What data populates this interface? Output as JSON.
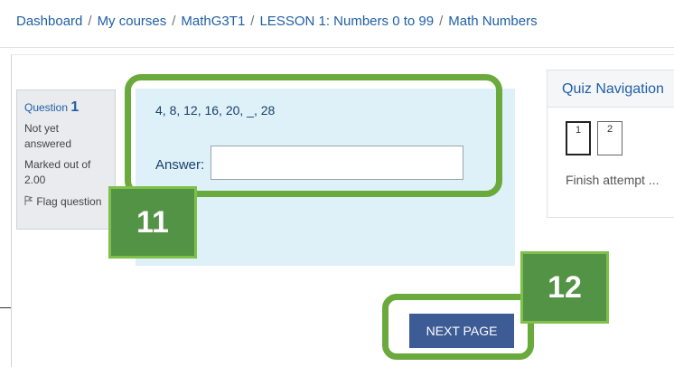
{
  "breadcrumb": {
    "items": [
      "Dashboard",
      "My courses",
      "MathG3T1",
      "LESSON 1: Numbers 0 to 99",
      "Math Numbers"
    ],
    "separator": "/"
  },
  "question_info": {
    "label": "Question",
    "number": "1",
    "state": "Not yet answered",
    "mark": "Marked out of 2.00",
    "flag_label": "Flag question"
  },
  "question": {
    "text": "4, 8, 12, 16, 20, _, 28",
    "answer_label": "Answer:",
    "answer_value": ""
  },
  "quiz_nav": {
    "title": "Quiz Navigation",
    "buttons": [
      "1",
      "2"
    ],
    "current": "1",
    "finish_link": "Finish attempt ..."
  },
  "footer": {
    "next_label": "NEXT PAGE"
  },
  "annotations": {
    "badge_11": "11",
    "badge_12": "12"
  },
  "colors": {
    "highlight": "#6aa93b",
    "badge": "#539345",
    "next_button": "#3d5b95",
    "link": "#1f5fa6",
    "question_bg": "#dff1f8"
  }
}
